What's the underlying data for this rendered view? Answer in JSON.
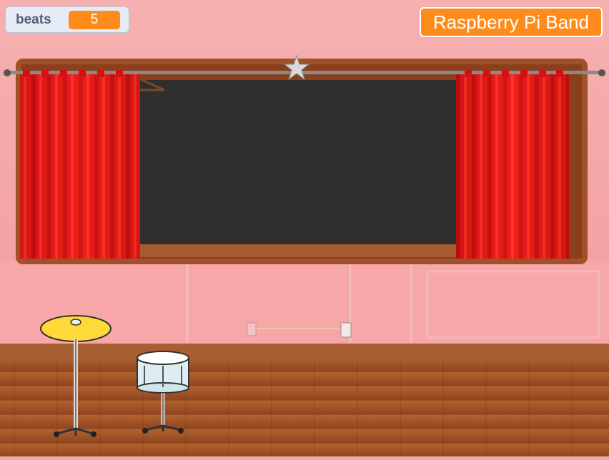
{
  "monitor": {
    "label": "beats",
    "value": "5"
  },
  "title": "Raspberry Pi Band",
  "sprites": [
    {
      "name": "cymbal-icon"
    },
    {
      "name": "snare-drum-icon"
    }
  ],
  "backdrop": "stage-room",
  "colors": {
    "accent": "#ff8c1a",
    "curtain": "#e01515",
    "wall": "#f2a8a8",
    "floor": "#a8582a"
  }
}
